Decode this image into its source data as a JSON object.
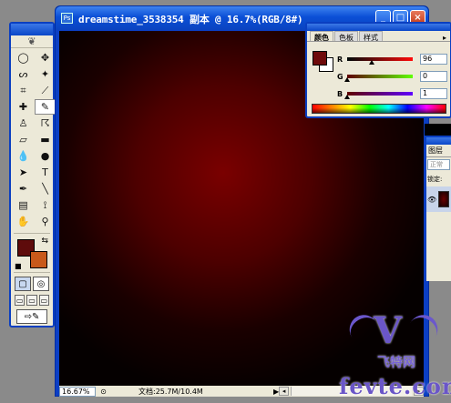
{
  "document": {
    "title": "dreamstime_3538354 副本 @ 16.7%(RGB/8#)",
    "window_buttons": {
      "minimize": "_",
      "restore": "□",
      "close": "×"
    },
    "status": {
      "zoom": "16.67%",
      "doc_info": "文档:25.7M/10.4M",
      "arrow": "▶"
    }
  },
  "toolbox": {
    "tools": [
      {
        "name": "marquee",
        "glyph": "◯"
      },
      {
        "name": "move",
        "glyph": "✥"
      },
      {
        "name": "lasso",
        "glyph": "ᔕ"
      },
      {
        "name": "magic-wand",
        "glyph": "✦"
      },
      {
        "name": "crop",
        "glyph": "⌗"
      },
      {
        "name": "slice",
        "glyph": "⟋"
      },
      {
        "name": "healing",
        "glyph": "✚"
      },
      {
        "name": "brush",
        "glyph": "✎"
      },
      {
        "name": "stamp",
        "glyph": "♙"
      },
      {
        "name": "history-brush",
        "glyph": "☈"
      },
      {
        "name": "eraser",
        "glyph": "▱"
      },
      {
        "name": "gradient",
        "glyph": "▬"
      },
      {
        "name": "blur",
        "glyph": "💧"
      },
      {
        "name": "dodge",
        "glyph": "●"
      },
      {
        "name": "path-select",
        "glyph": "➤"
      },
      {
        "name": "type",
        "glyph": "T"
      },
      {
        "name": "pen",
        "glyph": "✒"
      },
      {
        "name": "line",
        "glyph": "╲"
      },
      {
        "name": "notes",
        "glyph": "▤"
      },
      {
        "name": "eyedropper",
        "glyph": "⟟"
      },
      {
        "name": "hand",
        "glyph": "✋"
      },
      {
        "name": "zoom",
        "glyph": "⚲"
      }
    ],
    "foreground_color": "#5e0b0b",
    "background_color": "#c8591a"
  },
  "color_palette": {
    "tabs": [
      "颜色",
      "色板",
      "样式"
    ],
    "foreground": "#6e0a0a",
    "channels": [
      {
        "label": "R",
        "value": "96",
        "gradient": "linear-gradient(90deg,#000a0a,#ff0a0a)",
        "position": 0.376
      },
      {
        "label": "G",
        "value": "0",
        "gradient": "linear-gradient(90deg,#600000,#60ff00)",
        "position": 0.0
      },
      {
        "label": "B",
        "value": "1",
        "gradient": "linear-gradient(90deg,#600000,#6000ff)",
        "position": 0.004
      }
    ]
  },
  "layers_palette": {
    "tab": "图层",
    "blend_mode": "正常",
    "lock_label": "锁定:"
  },
  "watermark": {
    "logo_letter": "V",
    "brand": "飞特网",
    "site": "fevte.com"
  }
}
